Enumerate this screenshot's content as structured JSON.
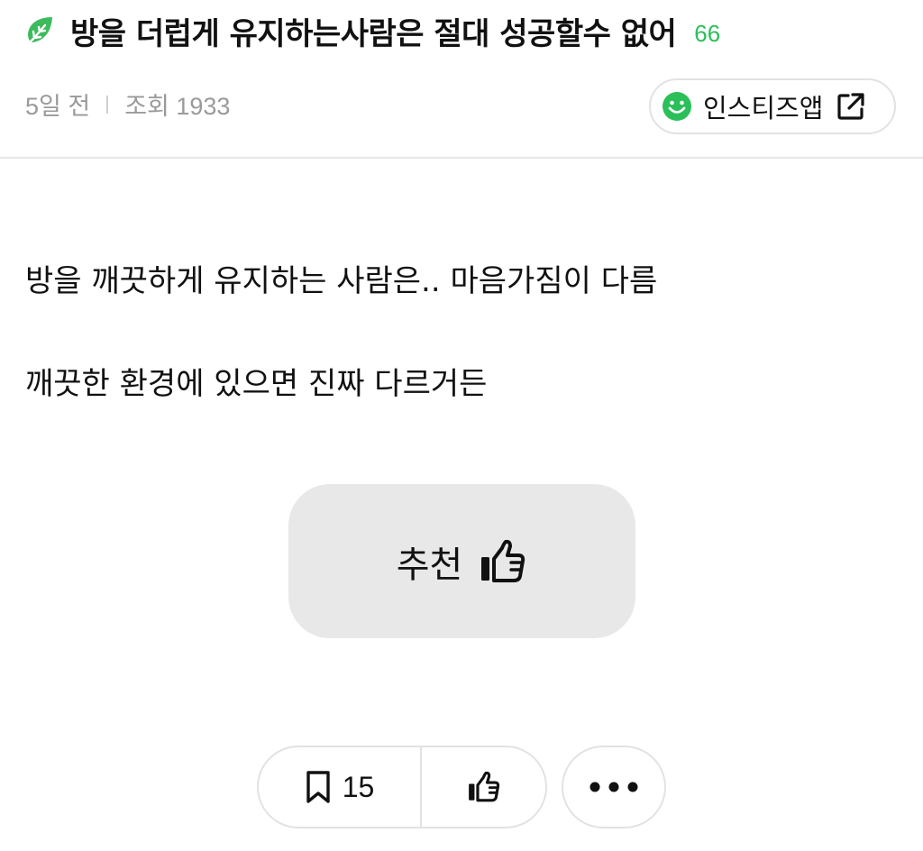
{
  "header": {
    "leaf_icon": "leaf-icon",
    "title": "방을 더럽게 유지하는사람은 절대 성공할수 없어",
    "comment_count": "66",
    "meta": {
      "time": "5일 전",
      "views": "조회 1933"
    },
    "app_button": {
      "icon": "smile-icon",
      "label": "인스티즈앱",
      "trailing_icon": "external-link-icon"
    }
  },
  "body": {
    "lines": [
      "방을 깨끗하게 유지하는 사람은.. 마음가짐이 다름",
      "깨끗한 환경에 있으면 진짜 다르거든"
    ]
  },
  "recommend": {
    "label": "추천",
    "icon": "thumbs-up-icon"
  },
  "actions": {
    "bookmark": {
      "icon": "bookmark-icon",
      "count": "15"
    },
    "like": {
      "icon": "thumbs-up-icon"
    },
    "more": {
      "icon": "more-dots-icon"
    }
  },
  "colors": {
    "accent_green": "#2bbf5a",
    "meta_gray": "#9a9a9a",
    "button_bg": "#e8e8e8",
    "border": "#e2e2e2"
  }
}
